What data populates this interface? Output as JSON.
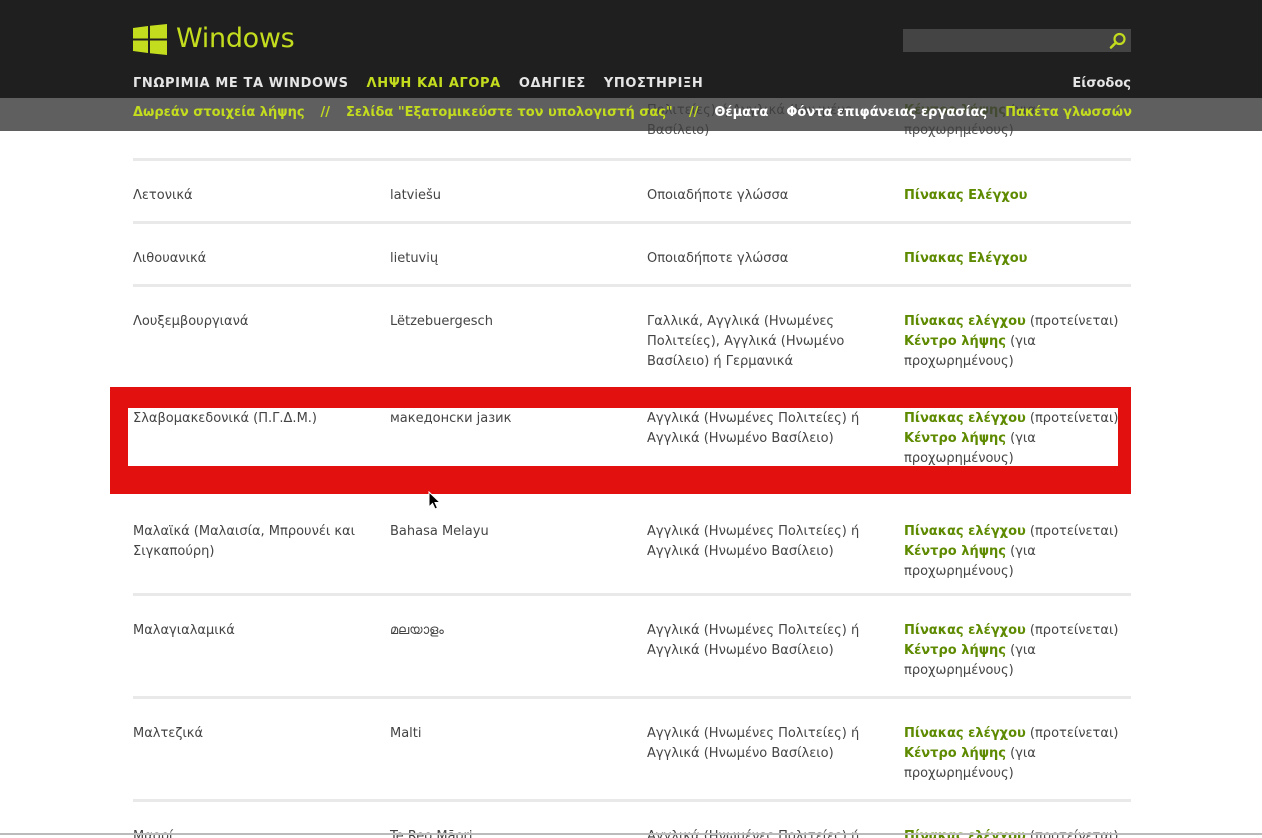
{
  "header": {
    "logo_text": "Windows",
    "nav": [
      "ΓΝΩΡΙΜΙΑ ΜΕ ΤΑ WINDOWS",
      "ΛΗΨΗ ΚΑΙ ΑΓΟΡΑ",
      "ΟΔΗΓΙΕΣ",
      "ΥΠΟΣΤΗΡΙΞΗ"
    ],
    "signin": "Είσοδος",
    "search_placeholder": ""
  },
  "subnav": {
    "link1": "Δωρεάν στοιχεία λήψης",
    "separator": "//",
    "link2": "Σελίδα \"Εξατομικεύστε τον υπολογιστή σας\"",
    "item3": "Θέματα",
    "item4": "Φόντα επιφάνειας εργασίας",
    "item5": "Πακέτα γλωσσών"
  },
  "partial_top": {
    "c3": "Πολιτείες) ή Αγγλικά (Ηνωμένο Βασίλειο)",
    "c4": "Κέντρο λήψης (για προχωρημένους)"
  },
  "rows": [
    {
      "lang": "Λετονικά",
      "native": "latviešu",
      "base": "Οποιαδήποτε γλώσσα",
      "link1": "Πίνακας Ελέγχου",
      "link1_suffix": "",
      "link2": "",
      "link2_suffix": ""
    },
    {
      "lang": "Λιθουανικά",
      "native": "lietuvių",
      "base": "Οποιαδήποτε γλώσσα",
      "link1": "Πίνακας Ελέγχου",
      "link1_suffix": "",
      "link2": "",
      "link2_suffix": ""
    },
    {
      "lang": "Λουξεμβουργιανά",
      "native": "Lëtzebuergesch",
      "base": "Γαλλικά, Αγγλικά (Ηνωμένες Πολιτείες), Αγγλικά (Ηνωμένο Βασίλειο) ή Γερμανικά",
      "link1": "Πίνακας ελέγχου",
      "link1_suffix": " (προτείνεται)",
      "link2": "Κέντρο λήψης",
      "link2_suffix": " (για προχωρημένους)"
    },
    {
      "lang": "Σλαβομακεδονικά (Π.Γ.Δ.Μ.)",
      "native": "македонски јазик",
      "base": "Αγγλικά (Ηνωμένες Πολιτείες) ή Αγγλικά (Ηνωμένο Βασίλειο)",
      "link1": "Πίνακας ελέγχου",
      "link1_suffix": " (προτείνεται)",
      "link2": "Κέντρο λήψης",
      "link2_suffix": " (για προχωρημένους)"
    },
    {
      "lang": "Μαλαϊκά (Μαλαισία, Μπρουνέι και Σιγκαπούρη)",
      "native": "Bahasa Melayu",
      "base": "Αγγλικά (Ηνωμένες Πολιτείες) ή Αγγλικά (Ηνωμένο Βασίλειο)",
      "link1": "Πίνακας ελέγχου",
      "link1_suffix": " (προτείνεται)",
      "link2": "Κέντρο λήψης",
      "link2_suffix": " (για προχωρημένους)"
    },
    {
      "lang": "Μαλαγιαλαμικά",
      "native": "മലയാളം",
      "base": "Αγγλικά (Ηνωμένες Πολιτείες) ή Αγγλικά (Ηνωμένο Βασίλειο)",
      "link1": "Πίνακας ελέγχου",
      "link1_suffix": " (προτείνεται)",
      "link2": "Κέντρο λήψης",
      "link2_suffix": " (για προχωρημένους)"
    },
    {
      "lang": "Μαλτεζικά",
      "native": "Malti",
      "base": "Αγγλικά (Ηνωμένες Πολιτείες) ή Αγγλικά (Ηνωμένο Βασίλειο)",
      "link1": "Πίνακας ελέγχου",
      "link1_suffix": " (προτείνεται)",
      "link2": "Κέντρο λήψης",
      "link2_suffix": " (για προχωρημένους)"
    },
    {
      "lang": "Μαορί",
      "native": "Te Reo Māori",
      "base": "Αγγλικά (Ηνωμένες Πολιτείες) ή",
      "link1": "Πίνακας ελέγχου",
      "link1_suffix": " (προτείνεται)",
      "link2": "",
      "link2_suffix": ""
    }
  ],
  "colors": {
    "accent": "#c4dc1e",
    "link": "#5e8a00",
    "highlight": "#e31010",
    "header_bg": "#1f1f1f"
  }
}
